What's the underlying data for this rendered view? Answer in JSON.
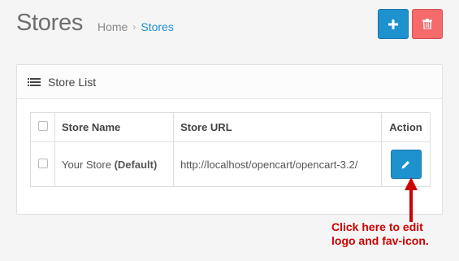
{
  "header": {
    "title": "Stores",
    "breadcrumb": [
      {
        "label": "Home"
      },
      {
        "label": "Stores"
      }
    ],
    "buttons": {
      "add_icon": "plus-icon",
      "delete_icon": "trash-icon"
    }
  },
  "panel": {
    "title": "Store List",
    "icon": "list-icon"
  },
  "table": {
    "columns": [
      "Store Name",
      "Store URL",
      "Action"
    ],
    "rows": [
      {
        "name": "Your Store",
        "name_suffix": "(Default)",
        "url": "http://localhost/opencart/opencart-3.2/",
        "action_icon": "pencil-icon"
      }
    ]
  },
  "annotation": {
    "line1": "Click here to edit",
    "line2": "logo and fav-icon."
  },
  "colors": {
    "primary": "#1e91cf",
    "danger": "#f56b6b",
    "annotation": "#cc0000"
  }
}
